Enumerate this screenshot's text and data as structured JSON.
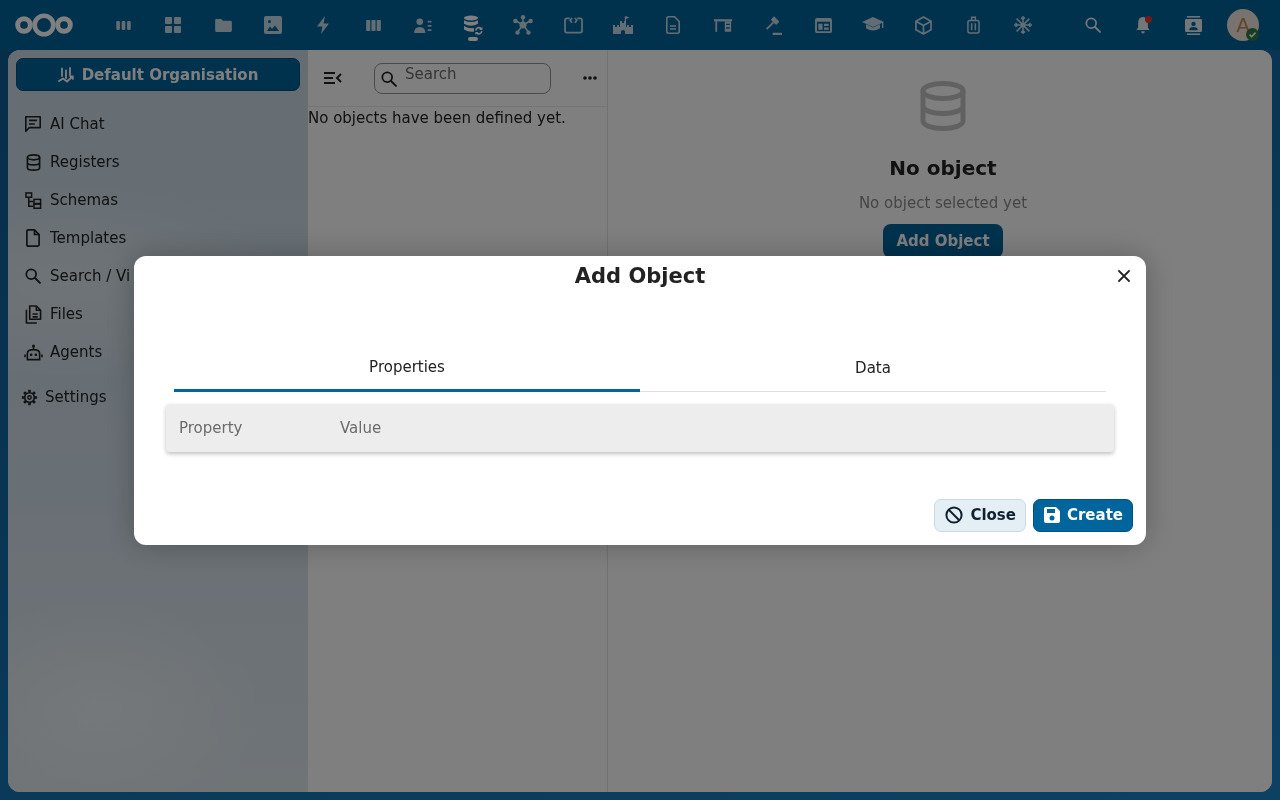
{
  "top_bar": {
    "apps": [
      {
        "selected": false
      },
      {
        "selected": false
      },
      {
        "selected": false
      },
      {
        "selected": false
      },
      {
        "selected": false
      },
      {
        "selected": false
      },
      {
        "selected": false
      },
      {
        "selected": true
      },
      {
        "selected": false
      },
      {
        "selected": false
      },
      {
        "selected": false
      },
      {
        "selected": false
      },
      {
        "selected": false
      },
      {
        "selected": false
      },
      {
        "selected": false
      },
      {
        "selected": false
      },
      {
        "selected": false
      },
      {
        "selected": false
      },
      {
        "selected": false
      }
    ],
    "notifications": {
      "unread": true
    },
    "avatar": {
      "initial": "A",
      "online": true
    }
  },
  "sidebar": {
    "organisation_button": "Default Organisation",
    "items": [
      {
        "label": "AI Chat",
        "selected": false
      },
      {
        "label": "Registers",
        "selected": false
      },
      {
        "label": "Schemas",
        "selected": false
      },
      {
        "label": "Templates",
        "selected": false
      },
      {
        "label": "Search / Vi",
        "selected": false
      },
      {
        "label": "Files",
        "selected": false
      },
      {
        "label": "Agents",
        "selected": false
      }
    ],
    "settings": "Settings"
  },
  "object_list": {
    "search": {
      "placeholder": "Search"
    },
    "empty_message": "No objects have been defined yet."
  },
  "detail": {
    "title": "No object",
    "subtitle": "No object selected yet",
    "button": "Add Object"
  },
  "dialog": {
    "title": "Add Object",
    "tabs": [
      {
        "label": "Properties",
        "selected": true
      },
      {
        "label": "Data",
        "selected": false
      }
    ],
    "table": {
      "columns": [
        "Property",
        "Value"
      ]
    },
    "buttons": [
      {
        "label": "Close",
        "kind": "secondary"
      },
      {
        "label": "Create",
        "kind": "primary"
      }
    ]
  }
}
